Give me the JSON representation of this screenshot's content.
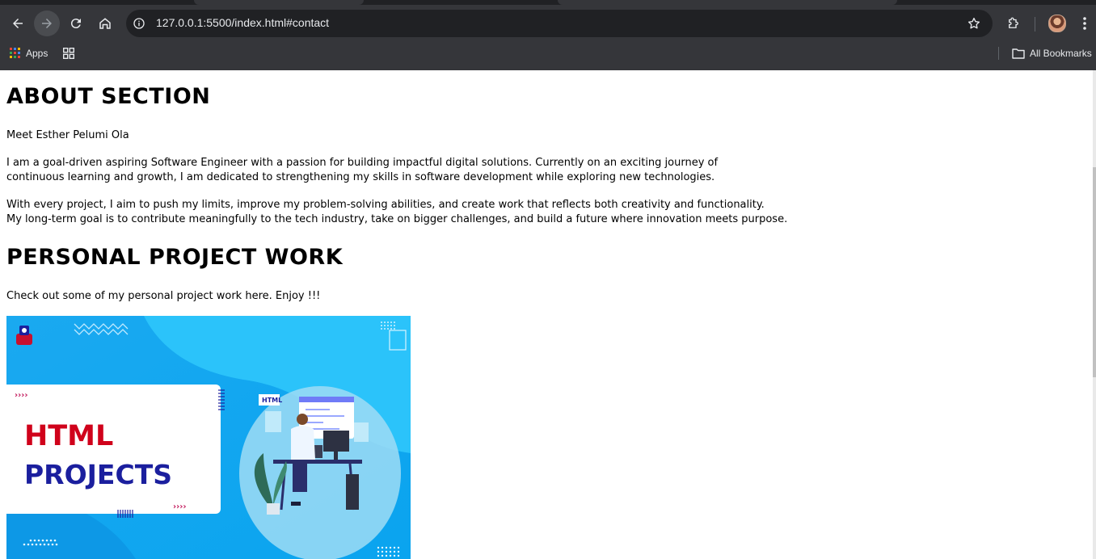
{
  "browser": {
    "url": "127.0.0.1:5500/index.html#contact",
    "bookmarks_bar": {
      "apps_label": "Apps",
      "all_bookmarks_label": "All Bookmarks"
    }
  },
  "about": {
    "heading": "ABOUT SECTION",
    "intro": "Meet Esther Pelumi Ola",
    "para1_line1": "I am a goal-driven aspiring Software Engineer with a passion for building impactful digital solutions. Currently on an exciting journey of",
    "para1_line2": "continuous learning and growth, I am dedicated to strengthening my skills in software development while exploring new technologies.",
    "para2_line1": "With every project, I aim to push my limits, improve my problem-solving abilities, and create work that reflects both creativity and functionality.",
    "para2_line2": "My long-term goal is to contribute meaningfully to the tech industry, take on bigger challenges, and build a future where innovation meets purpose."
  },
  "projects": {
    "heading": "PERSONAL PROJECT WORK",
    "intro": "Check out some of my personal project work here. Enjoy !!!",
    "banner": {
      "title_line1": "HTML",
      "title_line2": "PROJECTS",
      "badge": "HTML"
    }
  },
  "colors": {
    "chrome_bg": "#35363a",
    "omnibox_bg": "#202124",
    "banner_blue": "#12b5f2",
    "banner_red": "#d0021b",
    "banner_navy": "#1b1f9e"
  }
}
